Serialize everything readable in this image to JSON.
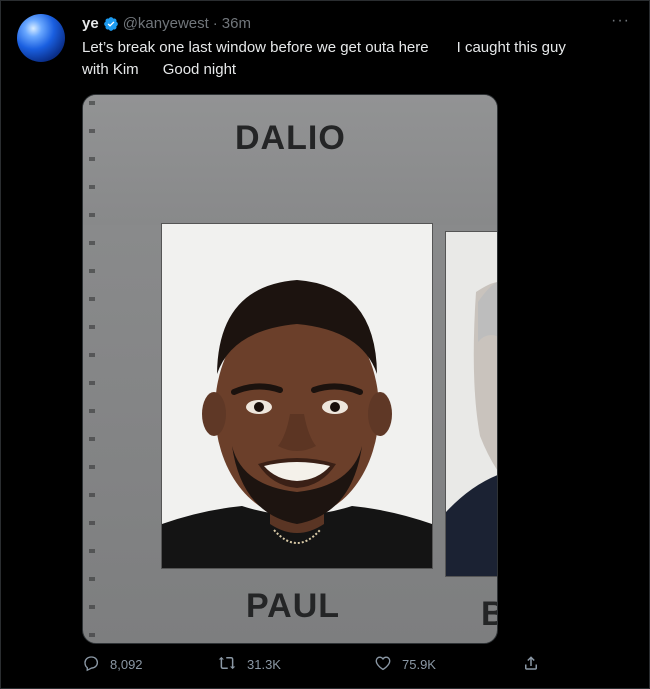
{
  "tweet": {
    "display_name": "ye",
    "handle": "@kanyewest",
    "separator": "·",
    "time": "36m",
    "more_label": "···",
    "line1_part1": "Let’s break one last window before we get outa here",
    "line1_part2": "I caught this guy",
    "line2_part1": "with Kim",
    "line2_part2": "Good night",
    "colors": {
      "verified": "#1d9bf0",
      "muted": "#71767b",
      "text": "#e7e9ea"
    }
  },
  "media": {
    "top_label": "DALIO",
    "bottom_label": "PAUL",
    "clipped_label": "B"
  },
  "actions": {
    "reply_count": "8,092",
    "retweet_count": "31.3K",
    "like_count": "75.9K",
    "icons": [
      "reply-icon",
      "retweet-icon",
      "like-icon",
      "share-icon"
    ]
  }
}
